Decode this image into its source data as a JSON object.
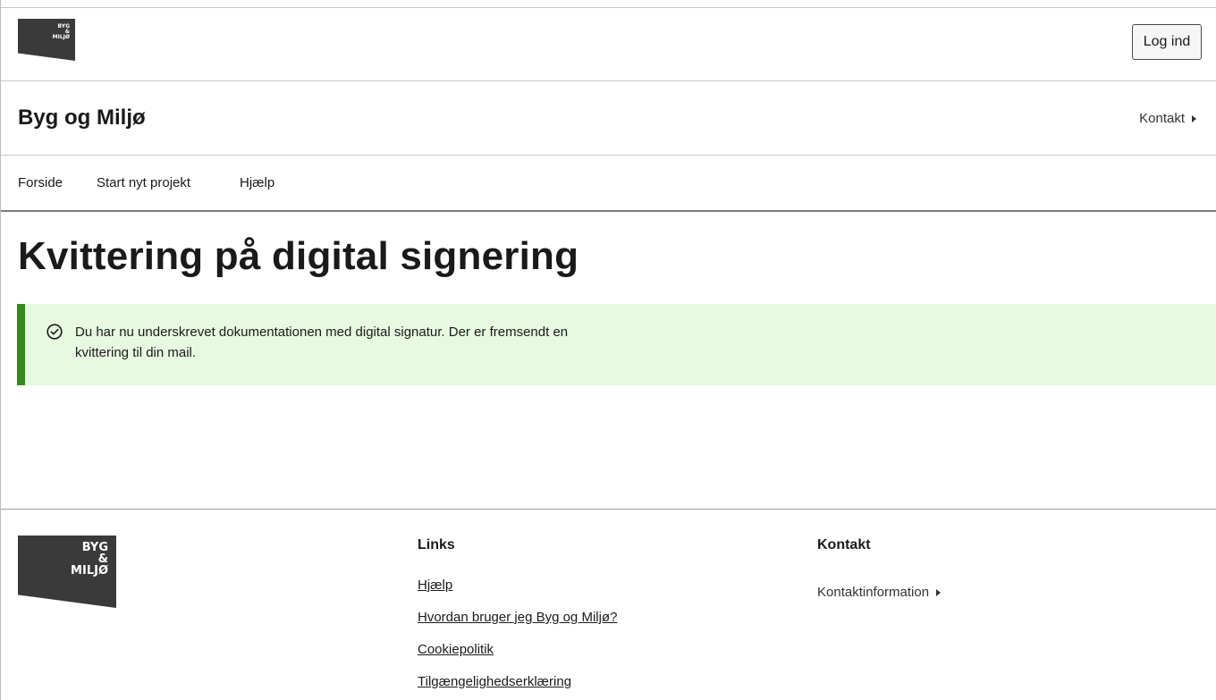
{
  "brand": {
    "logo_text": "BYG\n&\nMILJØ"
  },
  "topbar": {
    "login_label": "Log ind"
  },
  "header": {
    "site_title": "Byg og Miljø",
    "contact_label": "Kontakt"
  },
  "nav": {
    "items": [
      {
        "label": "Forside"
      },
      {
        "label": "Start nyt projekt"
      },
      {
        "label": "Hjælp"
      }
    ]
  },
  "main": {
    "title": "Kvittering på digital signering",
    "alert": {
      "icon": "check-circle-icon",
      "line1": "Du har nu underskrevet dokumentationen med digital signatur. Der er fremsendt en",
      "line2": "kvittering til din mail.",
      "accent_color": "#358a1e",
      "background_color": "#e8f9e1"
    }
  },
  "footer": {
    "links_heading": "Links",
    "links": [
      {
        "label": "Hjælp"
      },
      {
        "label": "Hvordan bruger jeg Byg og Miljø?"
      },
      {
        "label": "Cookiepolitik"
      },
      {
        "label": "Tilgængelighedserklæring"
      }
    ],
    "contact_heading": "Kontakt",
    "contact_link": "Kontaktinformation"
  }
}
